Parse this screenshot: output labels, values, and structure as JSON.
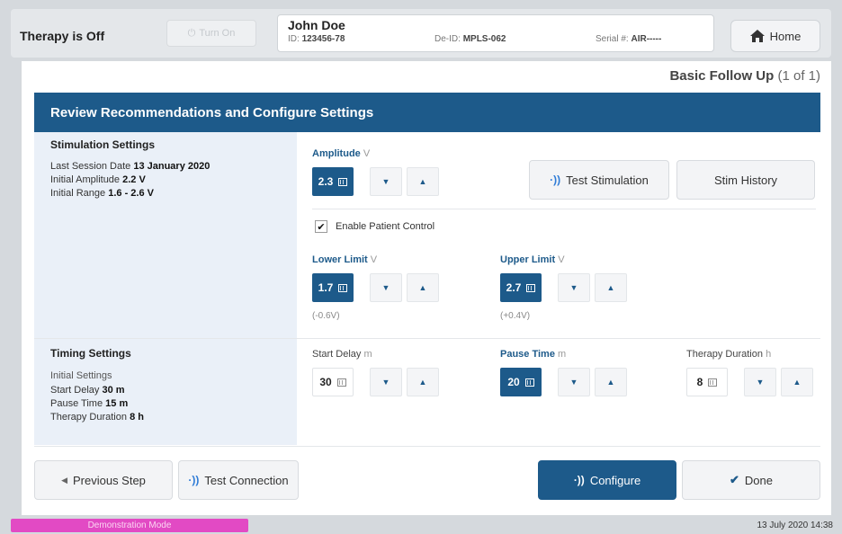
{
  "header": {
    "therapy_status": "Therapy is Off",
    "turn_on_label": "Turn On",
    "patient": {
      "name": "John Doe",
      "id_label": "ID:",
      "id_value": "123456-78",
      "deid_label": "De-ID:",
      "deid_value": "MPLS-062",
      "serial_label": "Serial #:",
      "serial_value": "AIR-----"
    },
    "home_label": "Home"
  },
  "page": {
    "followup_title": "Basic Follow Up",
    "followup_count": "(1 of 1)",
    "section_title": "Review Recommendations and Configure Settings"
  },
  "stimulation": {
    "heading": "Stimulation Settings",
    "last_session_label": "Last Session Date",
    "last_session_value": "13 January 2020",
    "initial_amplitude_label": "Initial Amplitude",
    "initial_amplitude_value": "2.2 V",
    "initial_range_label": "Initial Range",
    "initial_range_value": "1.6 - 2.6 V",
    "amplitude": {
      "label": "Amplitude",
      "unit": "V",
      "value": "2.3"
    },
    "test_stimulation_label": "Test Stimulation",
    "stim_history_label": "Stim History",
    "enable_patient_control_label": "Enable Patient Control",
    "enable_patient_control_checked": true,
    "lower_limit": {
      "label": "Lower Limit",
      "unit": "V",
      "value": "1.7",
      "delta": "(-0.6V)"
    },
    "upper_limit": {
      "label": "Upper Limit",
      "unit": "V",
      "value": "2.7",
      "delta": "(+0.4V)"
    }
  },
  "timing": {
    "heading": "Timing Settings",
    "initial_label": "Initial Settings",
    "start_delay_label": "Start Delay",
    "start_delay_initial": "30 m",
    "pause_time_label": "Pause Time",
    "pause_time_initial": "15 m",
    "therapy_duration_label": "Therapy Duration",
    "therapy_duration_initial": "8 h",
    "start_delay": {
      "label": "Start Delay",
      "unit": "m",
      "value": "30"
    },
    "pause_time": {
      "label": "Pause Time",
      "unit": "m",
      "value": "20"
    },
    "therapy_duration": {
      "label": "Therapy Duration",
      "unit": "h",
      "value": "8"
    }
  },
  "footer_buttons": {
    "previous_label": "Previous Step",
    "test_connection_label": "Test Connection",
    "configure_label": "Configure",
    "done_label": "Done"
  },
  "status_bar": {
    "demo_mode": "Demonstration Mode",
    "datetime": "13 July 2020 14:38"
  },
  "colors": {
    "primary": "#1d5a8a",
    "demo_badge": "#e24ac4",
    "left_panel": "#eaf0f8"
  },
  "icons": {
    "home": "home-icon",
    "wave": "wireless-wave-icon",
    "check": "checkmark-icon",
    "keypad": "keypad-icon"
  }
}
